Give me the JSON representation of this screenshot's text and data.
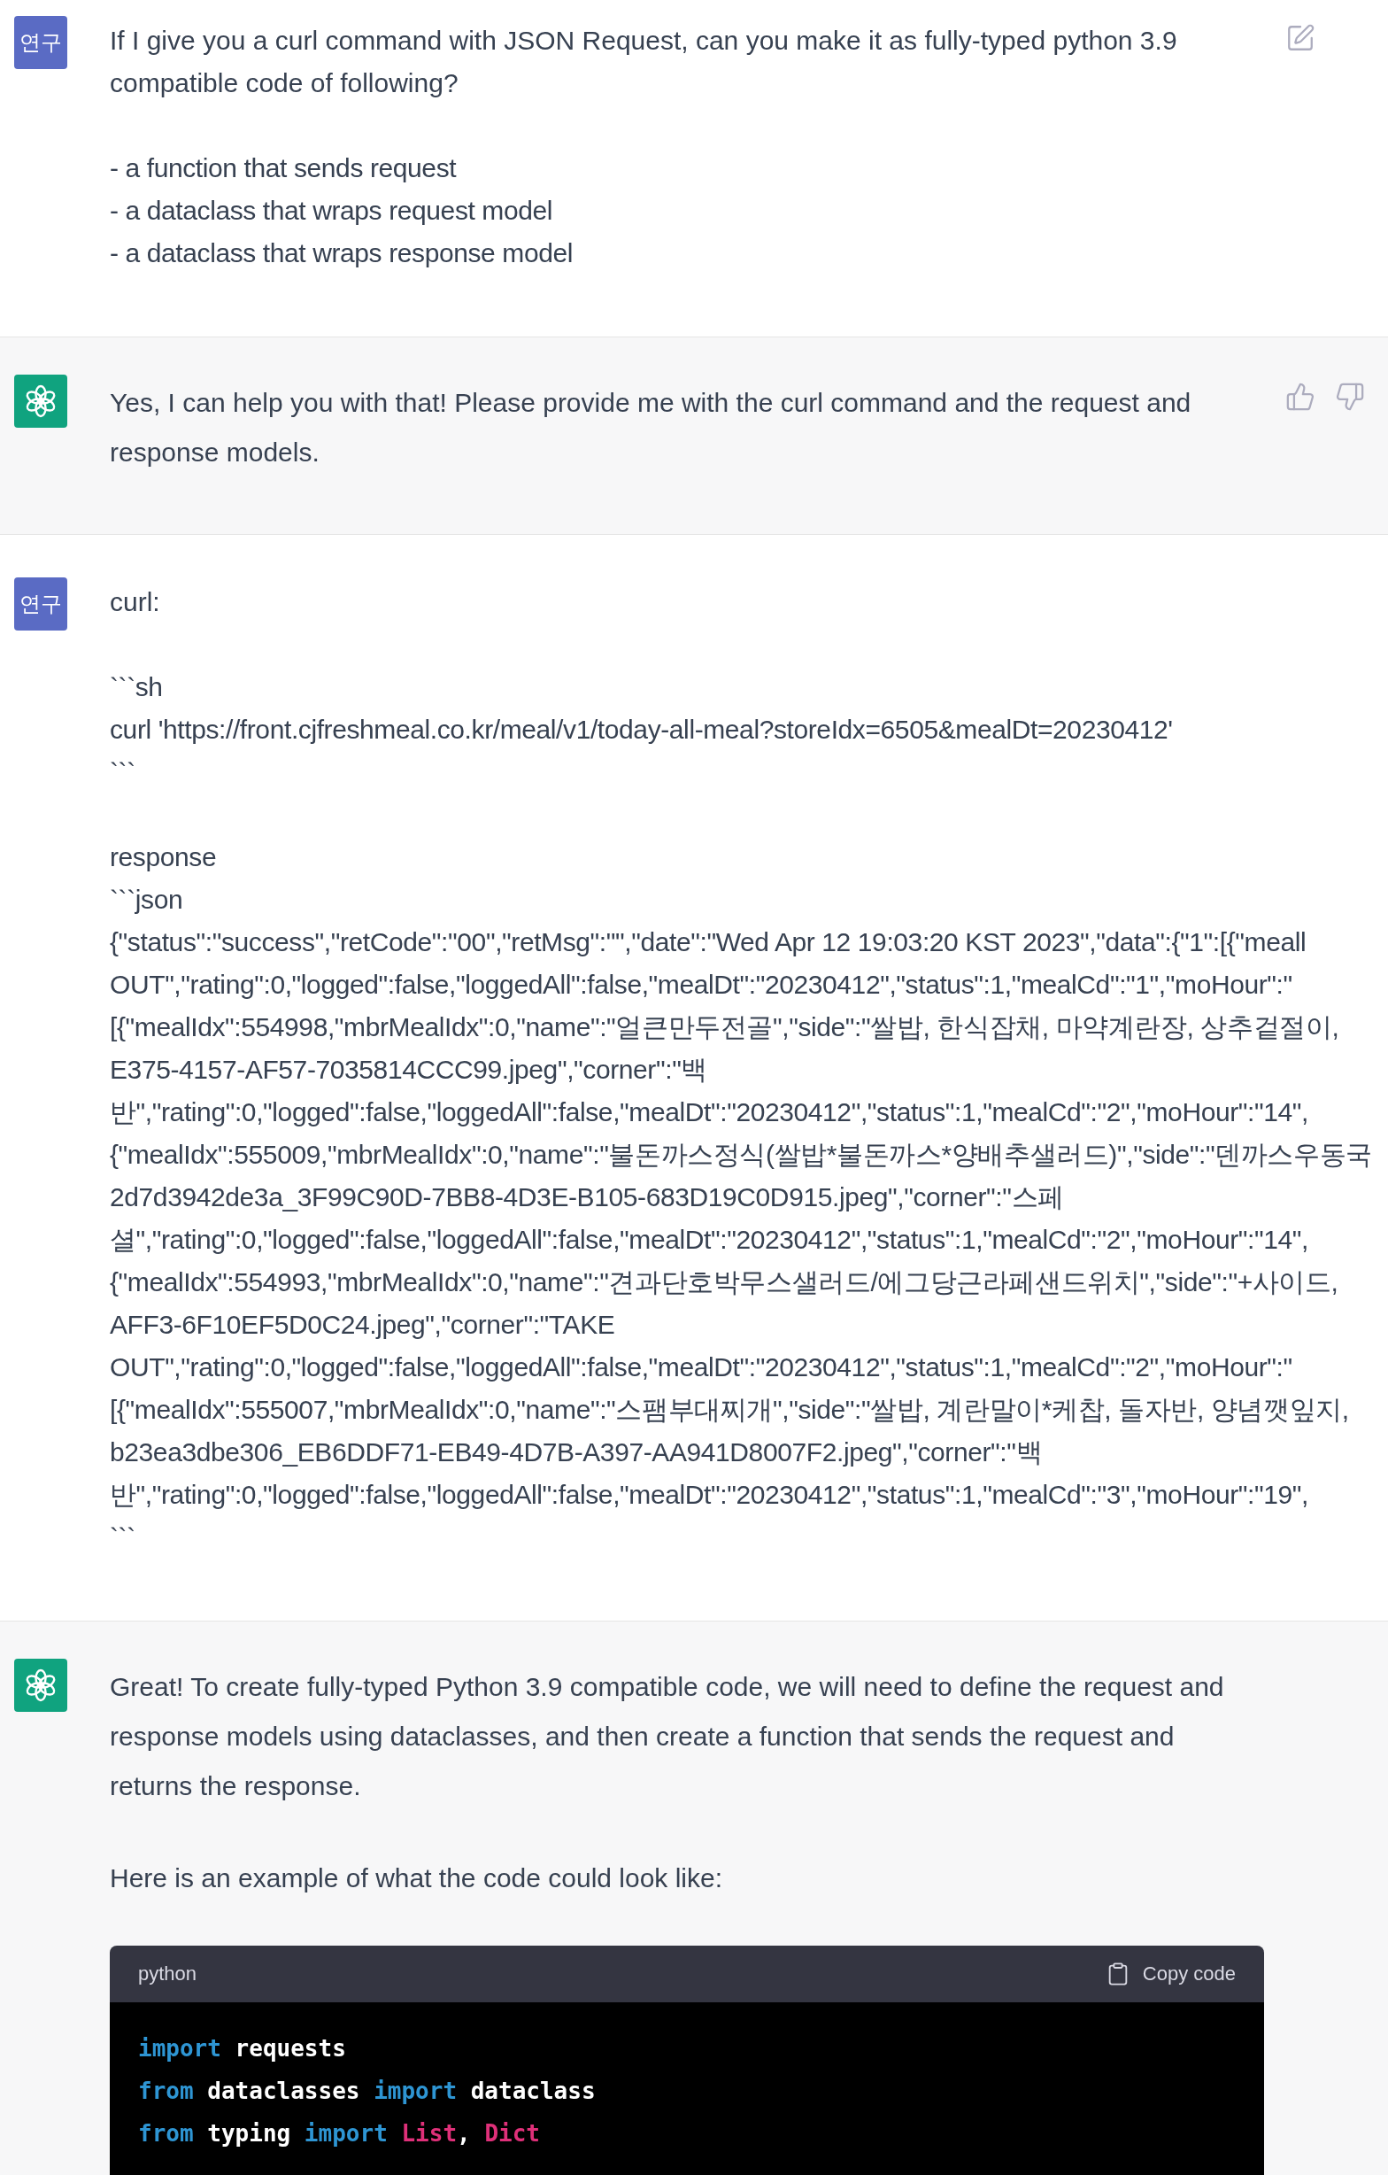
{
  "messages": [
    {
      "kind": "user",
      "editable": true,
      "avatar": "연구",
      "paragraphs": [
        [
          "If I give you a curl command with JSON Request, can you make it as fully-typed python 3.9 compatible code of following?"
        ],
        [
          "- a function that sends request",
          "- a dataclass that wraps request model",
          "- a dataclass that wraps response model"
        ]
      ]
    },
    {
      "kind": "assistant",
      "paragraphs": [
        [
          "Yes, I can help you with that! Please provide me with the curl command and the request and response models."
        ]
      ]
    },
    {
      "kind": "user",
      "editable": false,
      "avatar": "연구",
      "paragraphs": [
        [
          "curl:"
        ],
        [
          "```sh",
          "curl 'https://front.cjfreshmeal.co.kr/meal/v1/today-all-meal?storeIdx=6505&mealDt=20230412'",
          "```"
        ],
        [
          "response",
          "```json",
          "{\"status\":\"success\",\"retCode\":\"00\",\"retMsg\":\"\",\"date\":\"Wed Apr 12 19:03:20 KST 2023\",\"data\":{\"1\":[{\"meall",
          "OUT\",\"rating\":0,\"logged\":false,\"loggedAll\":false,\"mealDt\":\"20230412\",\"status\":1,\"mealCd\":\"1\",\"moHour\":\"",
          "[{\"mealIdx\":554998,\"mbrMealIdx\":0,\"name\":\"얼큰만두전골\",\"side\":\"쌀밥, 한식잡채, 마약계란장, 상추겉절이,",
          "E375-4157-AF57-7035814CCC99.jpeg\",\"corner\":\"백",
          "반\",\"rating\":0,\"logged\":false,\"loggedAll\":false,\"mealDt\":\"20230412\",\"status\":1,\"mealCd\":\"2\",\"moHour\":\"14\",",
          "{\"mealIdx\":555009,\"mbrMealIdx\":0,\"name\":\"불돈까스정식(쌀밥*불돈까스*양배추샐러드)\",\"side\":\"덴까스우동국",
          "2d7d3942de3a_3F99C90D-7BB8-4D3E-B105-683D19C0D915.jpeg\",\"corner\":\"스페",
          "셜\",\"rating\":0,\"logged\":false,\"loggedAll\":false,\"mealDt\":\"20230412\",\"status\":1,\"mealCd\":\"2\",\"moHour\":\"14\",",
          "{\"mealIdx\":554993,\"mbrMealIdx\":0,\"name\":\"견과단호박무스샐러드/에그당근라페샌드위치\",\"side\":\"+사이드,",
          "AFF3-6F10EF5D0C24.jpeg\",\"corner\":\"TAKE",
          "OUT\",\"rating\":0,\"logged\":false,\"loggedAll\":false,\"mealDt\":\"20230412\",\"status\":1,\"mealCd\":\"2\",\"moHour\":\"",
          "[{\"mealIdx\":555007,\"mbrMealIdx\":0,\"name\":\"스팸부대찌개\",\"side\":\"쌀밥, 계란말이*케찹, 돌자반, 양념깻잎지,",
          "b23ea3dbe306_EB6DDF71-EB49-4D7B-A397-AA941D8007F2.jpeg\",\"corner\":\"백",
          "반\",\"rating\":0,\"logged\":false,\"loggedAll\":false,\"mealDt\":\"20230412\",\"status\":1,\"mealCd\":\"3\",\"moHour\":\"19\",",
          "```"
        ]
      ]
    },
    {
      "kind": "assistant",
      "paragraphs": [
        [
          "Great! To create fully-typed Python 3.9 compatible code, we will need to define the request and response models using dataclasses, and then create a function that sends the request and returns the response."
        ],
        [
          "Here is an example of what the code could look like:"
        ]
      ],
      "code": {
        "language": "python",
        "copy_label": "Copy code",
        "lines": [
          [
            {
              "kind": "keyword",
              "text": "import"
            },
            {
              "kind": "plain",
              "text": " requests"
            }
          ],
          [
            {
              "kind": "keyword",
              "text": "from"
            },
            {
              "kind": "plain",
              "text": " dataclasses "
            },
            {
              "kind": "keyword",
              "text": "import"
            },
            {
              "kind": "plain",
              "text": " dataclass"
            }
          ],
          [
            {
              "kind": "keyword",
              "text": "from"
            },
            {
              "kind": "plain",
              "text": " typing "
            },
            {
              "kind": "keyword",
              "text": "import"
            },
            {
              "kind": "type",
              "text": " List"
            },
            {
              "kind": "plain",
              "text": ", "
            },
            {
              "kind": "type",
              "text": "Dict"
            }
          ]
        ]
      }
    }
  ]
}
